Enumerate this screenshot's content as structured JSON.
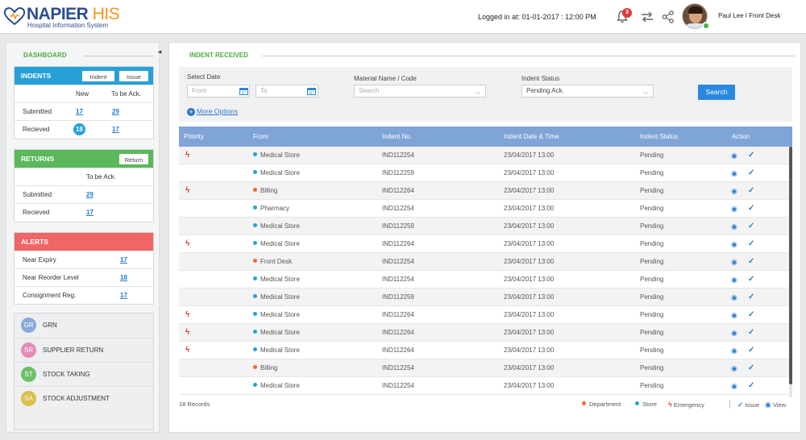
{
  "header": {
    "brand_main": "NAPIER",
    "brand_accent": "HIS",
    "brand_sub": "Hospital Information System",
    "logged_in": "Logged in at: 01-01-2017 : 12:00 PM",
    "notification_count": "3",
    "user": "Paul Lee I Front Desk",
    "colors": {
      "brand": "#2e4d8f",
      "accent": "#f7941d",
      "badge": "#e23b3b"
    }
  },
  "sidebar": {
    "title": "DASHBOARD",
    "collapse_glyph": "◂",
    "indents": {
      "title": "INDENTS",
      "btn_indent": "Indent",
      "btn_issue": "Issue",
      "col_new": "New",
      "col_ack": "To be Ack.",
      "rows": [
        {
          "label": "Submitted",
          "new": "17",
          "ack": "29"
        },
        {
          "label": "Recieved",
          "new": "18",
          "ack": "17"
        }
      ],
      "color": "#27a0d8"
    },
    "returns": {
      "title": "RETURNS",
      "btn_return": "Return",
      "col_ack": "To be Ack.",
      "rows": [
        {
          "label": "Submitted",
          "ack": "29"
        },
        {
          "label": "Recieved",
          "ack": "17"
        }
      ],
      "color": "#5cb85c"
    },
    "alerts": {
      "title": "ALERTS",
      "rows": [
        {
          "label": "Near Expiry",
          "value": "17"
        },
        {
          "label": "Near Reorder Level",
          "value": "18"
        },
        {
          "label": "Consignment Reg.",
          "value": "17"
        }
      ],
      "color": "#f06565"
    },
    "quick_links": [
      {
        "abbr": "GR",
        "label": "GRN",
        "color": "#8aa8d8"
      },
      {
        "abbr": "SR",
        "label": "SUPPLIER RETURN",
        "color": "#e58bb8"
      },
      {
        "abbr": "ST",
        "label": "STOCK TAKING",
        "color": "#6cc06a"
      },
      {
        "abbr": "SA",
        "label": "STOCK ADJUSTMENT",
        "color": "#d8c04a"
      }
    ]
  },
  "main": {
    "title": "INDENT RECEIVED",
    "filters": {
      "select_date_label": "Select Date",
      "from_placeholder": "From",
      "to_placeholder": "To",
      "material_label": "Material Name / Code",
      "material_placeholder": "Search",
      "status_label": "Indent Status",
      "status_value": "Pending Ack.",
      "search_button": "Search",
      "more_options": "More Options"
    },
    "table": {
      "columns": [
        "Priority",
        "From",
        "Indent No.",
        "Indent Date & Time",
        "Indent Status",
        "Action"
      ],
      "rows": [
        {
          "emergency": true,
          "type": "store",
          "from": "Medical Store",
          "no": "IND112254",
          "date": "23/04/2017 13:00",
          "status": "Pending"
        },
        {
          "emergency": false,
          "type": "store",
          "from": "Medical Store",
          "no": "IND112259",
          "date": "23/04/2017 13:00",
          "status": "Pending"
        },
        {
          "emergency": true,
          "type": "department",
          "from": "Billing",
          "no": "IND112264",
          "date": "23/04/2017 13:00",
          "status": "Pending"
        },
        {
          "emergency": false,
          "type": "store",
          "from": "Pharmacy",
          "no": "IND112254",
          "date": "23/04/2017 13:00",
          "status": "Pending"
        },
        {
          "emergency": false,
          "type": "store",
          "from": "Medical Store",
          "no": "IND112259",
          "date": "23/04/2017 13:00",
          "status": "Pending"
        },
        {
          "emergency": true,
          "type": "store",
          "from": "Medical Store",
          "no": "IND112264",
          "date": "23/04/2017 13:00",
          "status": "Pending"
        },
        {
          "emergency": false,
          "type": "department",
          "from": "Front Desk",
          "no": "IND112254",
          "date": "23/04/2017 13:00",
          "status": "Pending"
        },
        {
          "emergency": false,
          "type": "store",
          "from": "Medical Store",
          "no": "IND112254",
          "date": "23/04/2017 13:00",
          "status": "Pending"
        },
        {
          "emergency": false,
          "type": "store",
          "from": "Medical Store",
          "no": "IND112259",
          "date": "23/04/2017 13:00",
          "status": "Pending"
        },
        {
          "emergency": true,
          "type": "store",
          "from": "Medical Store",
          "no": "IND112264",
          "date": "23/04/2017 13:00",
          "status": "Pending"
        },
        {
          "emergency": true,
          "type": "store",
          "from": "Medical Store",
          "no": "IND112264",
          "date": "23/04/2017 13:00",
          "status": "Pending"
        },
        {
          "emergency": true,
          "type": "store",
          "from": "Medical Store",
          "no": "IND112264",
          "date": "23/04/2017 13:00",
          "status": "Pending"
        },
        {
          "emergency": false,
          "type": "department",
          "from": "Billing",
          "no": "IND112254",
          "date": "23/04/2017 13:00",
          "status": "Pending"
        },
        {
          "emergency": false,
          "type": "store",
          "from": "Medical Store",
          "no": "IND112254",
          "date": "23/04/2017 13:00",
          "status": "Pending"
        }
      ],
      "records": "18 Records",
      "action_icons": [
        "eye-icon",
        "check-icon"
      ]
    },
    "legend": {
      "department": "Department",
      "store": "Store",
      "emergency": "Emergency",
      "issue": "Issue",
      "view": "View",
      "colors": {
        "department": "#f06a2c",
        "store": "#27a0d8",
        "emergency": "#e0372f"
      }
    }
  }
}
